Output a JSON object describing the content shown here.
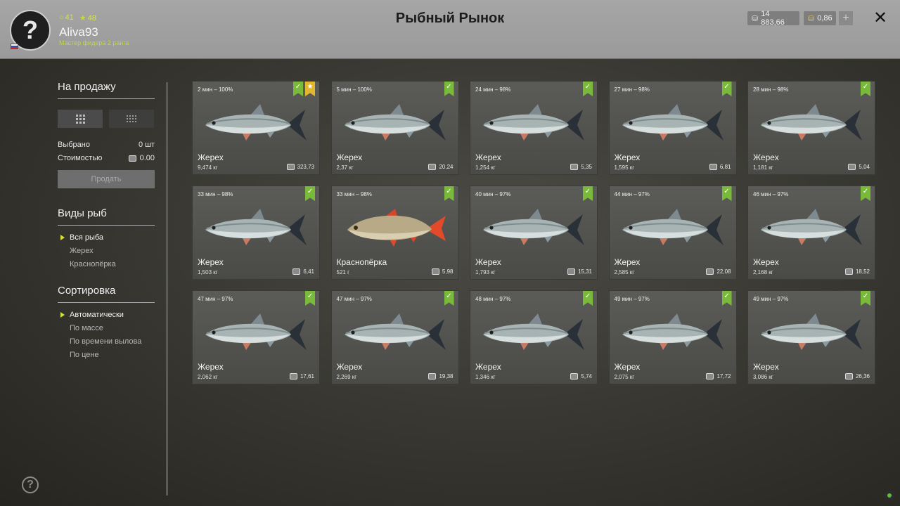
{
  "header": {
    "title": "Рыбный Рынок",
    "player": {
      "avatar_glyph": "?",
      "stat_a": "41",
      "stat_b": "48",
      "username": "Aliva93",
      "rank": "Мастер фидера 2 ранга"
    },
    "silver": "14 883,66",
    "gold": "0,86",
    "plus_glyph": "+",
    "close_glyph": "✕"
  },
  "colors": {
    "accent_green": "#7aba3a",
    "star_gold": "#e2b62e",
    "rank_text": "#c4d63a"
  },
  "sidebar": {
    "for_sale_title": "На продажу",
    "selected_label": "Выбрано",
    "selected_value": "0 шт",
    "cost_label": "Стоимостью",
    "cost_value": "0.00",
    "sell_button": "Продать",
    "species_title": "Виды рыб",
    "species": [
      {
        "label": "Вся рыба",
        "active": true
      },
      {
        "label": "Жерех",
        "active": false
      },
      {
        "label": "Краснопёрка",
        "active": false
      }
    ],
    "sort_title": "Сортировка",
    "sort": [
      {
        "label": "Автоматически",
        "active": true
      },
      {
        "label": "По массе",
        "active": false
      },
      {
        "label": "По времени вылова",
        "active": false
      },
      {
        "label": "По цене",
        "active": false
      }
    ],
    "help_glyph": "?"
  },
  "fish": [
    {
      "time": "2 мин – 100%",
      "name": "Жерех",
      "weight": "9,474 кг",
      "price": "323,73",
      "star": true,
      "kind": "asp"
    },
    {
      "time": "5 мин – 100%",
      "name": "Жерех",
      "weight": "2,37 кг",
      "price": "20,24",
      "star": false,
      "kind": "asp"
    },
    {
      "time": "24 мин – 98%",
      "name": "Жерех",
      "weight": "1,254 кг",
      "price": "5,35",
      "star": false,
      "kind": "asp"
    },
    {
      "time": "27 мин – 98%",
      "name": "Жерех",
      "weight": "1,595 кг",
      "price": "6,81",
      "star": false,
      "kind": "asp"
    },
    {
      "time": "28 мин – 98%",
      "name": "Жерех",
      "weight": "1,181 кг",
      "price": "5,04",
      "star": false,
      "kind": "asp"
    },
    {
      "time": "33 мин – 98%",
      "name": "Жерех",
      "weight": "1,503 кг",
      "price": "6,41",
      "star": false,
      "kind": "asp"
    },
    {
      "time": "33 мин – 98%",
      "name": "Краснопёрка",
      "weight": "521 г",
      "price": "5,98",
      "star": false,
      "kind": "rudd"
    },
    {
      "time": "40 мин – 97%",
      "name": "Жерех",
      "weight": "1,793 кг",
      "price": "15,31",
      "star": false,
      "kind": "asp"
    },
    {
      "time": "44 мин – 97%",
      "name": "Жерех",
      "weight": "2,585 кг",
      "price": "22,08",
      "star": false,
      "kind": "asp"
    },
    {
      "time": "46 мин – 97%",
      "name": "Жерех",
      "weight": "2,168 кг",
      "price": "18,52",
      "star": false,
      "kind": "asp"
    },
    {
      "time": "47 мин – 97%",
      "name": "Жерех",
      "weight": "2,062 кг",
      "price": "17,61",
      "star": false,
      "kind": "asp"
    },
    {
      "time": "47 мин – 97%",
      "name": "Жерех",
      "weight": "2,269 кг",
      "price": "19,38",
      "star": false,
      "kind": "asp"
    },
    {
      "time": "48 мин – 97%",
      "name": "Жерех",
      "weight": "1,346 кг",
      "price": "5,74",
      "star": false,
      "kind": "asp"
    },
    {
      "time": "49 мин – 97%",
      "name": "Жерех",
      "weight": "2,075 кг",
      "price": "17,72",
      "star": false,
      "kind": "asp"
    },
    {
      "time": "49 мин – 97%",
      "name": "Жерех",
      "weight": "3,086 кг",
      "price": "26,36",
      "star": false,
      "kind": "asp"
    }
  ]
}
